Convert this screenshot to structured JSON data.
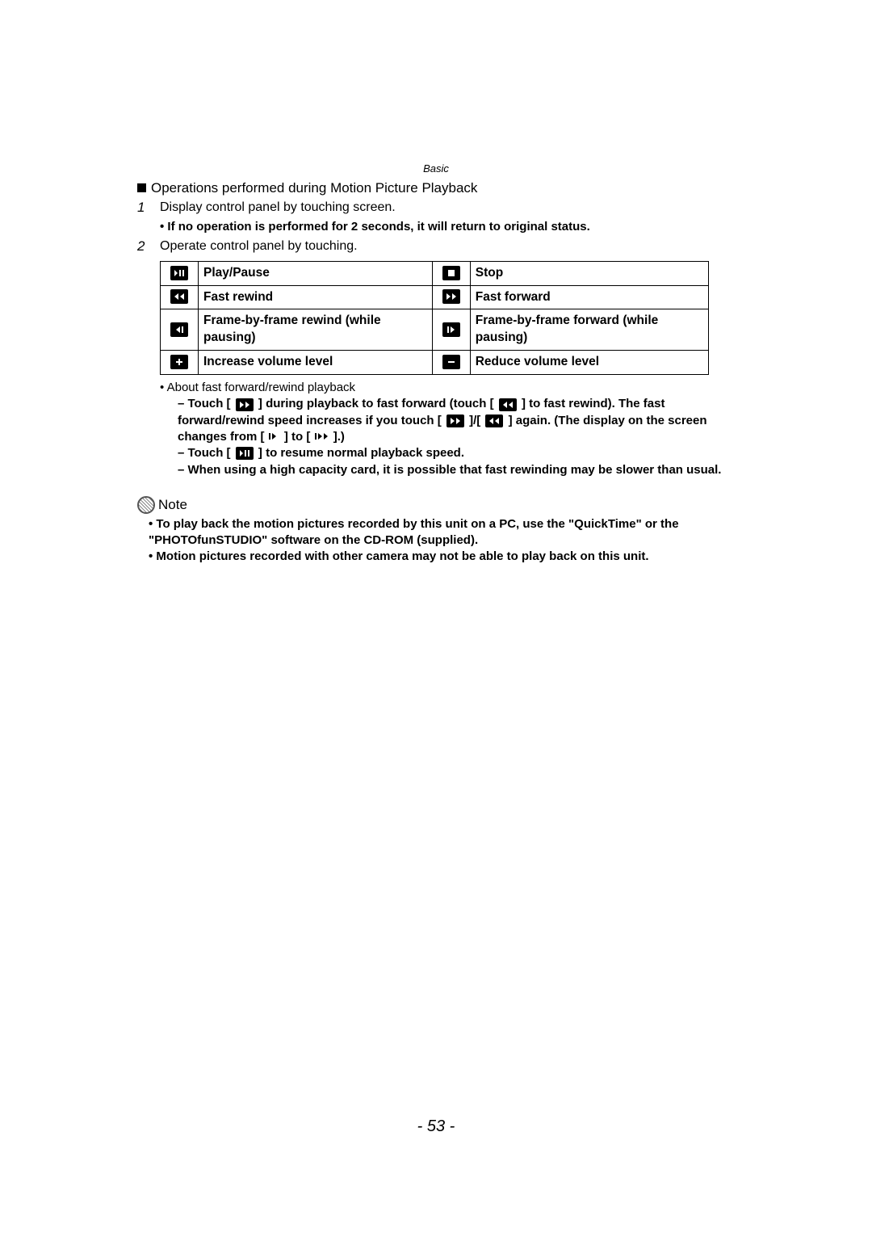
{
  "header": {
    "section": "Basic"
  },
  "title": "Operations performed during Motion Picture Playback",
  "steps": {
    "s1": {
      "num": "1",
      "text": "Display control panel by touching screen."
    },
    "s1_bullet": "• If no operation is performed for 2 seconds, it will return to original status.",
    "s2": {
      "num": "2",
      "text": "Operate control panel by touching."
    }
  },
  "table": {
    "r1c1": "Play/Pause",
    "r1c2": "Stop",
    "r2c1": "Fast rewind",
    "r2c2": "Fast forward",
    "r3c1": "Frame-by-frame rewind (while pausing)",
    "r3c2": "Frame-by-frame forward (while pausing)",
    "r4c1": "Increase volume level",
    "r4c2": "Reduce volume level"
  },
  "about": "• About fast forward/rewind playback",
  "ff": {
    "l1a": "– Touch [",
    "l1b": "] during playback to fast forward (touch [",
    "l1c": "] to fast rewind). The fast forward/rewind speed increases if you touch [",
    "l1d": "]/[",
    "l1e": "] again. (The display on the screen changes from [",
    "l1f": "] to [",
    "l1g": "].)",
    "l2a": "– Touch [",
    "l2b": "] to resume normal playback speed.",
    "l3": "– When using a high capacity card, it is possible that fast rewinding may be slower than usual."
  },
  "note": {
    "title": "Note",
    "b1": "• To play back the motion pictures recorded by this unit on a PC, use the \"QuickTime\" or the \"PHOTOfunSTUDIO\" software on the CD-ROM (supplied).",
    "b2": "• Motion pictures recorded with other camera may not be able to play back on this unit."
  },
  "page_number": "- 53 -"
}
